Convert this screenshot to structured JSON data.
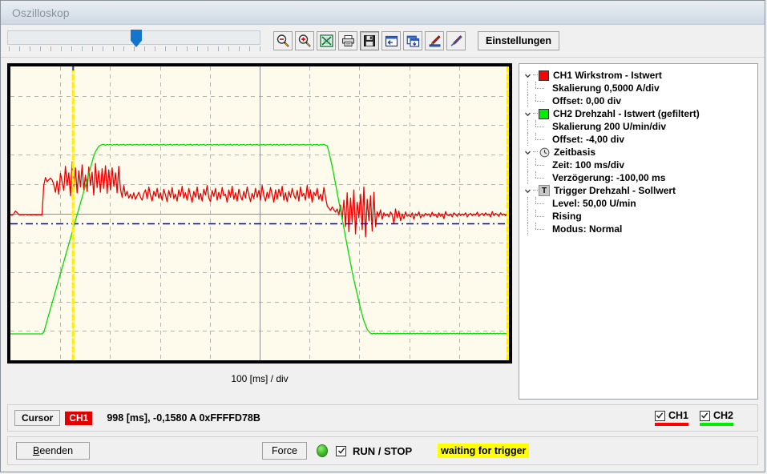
{
  "window": {
    "title": "Oszilloskop"
  },
  "toolbar": {
    "slider": {
      "name": "time-position-slider",
      "value": 50,
      "tick_count": 25
    },
    "buttons": [
      {
        "name": "zoom-out-button",
        "icon": "zoom-out-icon",
        "tooltip": "Zoom Out"
      },
      {
        "name": "zoom-in-button",
        "icon": "zoom-in-icon",
        "tooltip": "Zoom In"
      },
      {
        "name": "excel-export-button",
        "icon": "excel-icon",
        "tooltip": "Export Excel"
      },
      {
        "name": "print-button",
        "icon": "printer-icon",
        "tooltip": "Drucken"
      },
      {
        "name": "save-button",
        "icon": "floppy-disk-icon",
        "tooltip": "Speichern"
      },
      {
        "name": "load-window-button",
        "icon": "window-import-icon",
        "tooltip": "Laden"
      },
      {
        "name": "copy-window-button",
        "icon": "window-copy-icon",
        "tooltip": "Kopieren"
      },
      {
        "name": "marker-pen-button",
        "icon": "pen-blue-icon",
        "tooltip": "Marker"
      },
      {
        "name": "line-pen-button",
        "icon": "pen-line-icon",
        "tooltip": "Linie"
      }
    ],
    "settings_label": "Einstellungen"
  },
  "scope": {
    "x_axis_label": "100 [ms] / div",
    "colors": {
      "background": "#fffbec",
      "grid": "#b4b4b4",
      "axis": "#909090",
      "ch1": "#ee0000",
      "ch2": "#00dd00",
      "cursor": "#ffee00",
      "trigger_level": "#0000cc",
      "border": "#000000"
    },
    "grid": {
      "x_divisions": 10,
      "y_divisions": 10,
      "show": true
    },
    "cursor_position_div": 1.25,
    "trigger_level_y_div": 5.35
  },
  "tree": {
    "nodes": [
      {
        "name": "ch1-node",
        "icon": "color-swatch-red",
        "color": "#ff0000",
        "label": "CH1 Wirkstrom - Istwert",
        "children": [
          "Skalierung 0,5000 A/div",
          "Offset: 0,00  div"
        ]
      },
      {
        "name": "ch2-node",
        "icon": "color-swatch-green",
        "color": "#00ee00",
        "label": "CH2 Drehzahl - Istwert (gefiltert)",
        "children": [
          "Skalierung 200  U/min/div",
          "Offset: -4,00  div"
        ]
      },
      {
        "name": "timebase-node",
        "icon": "clock-icon",
        "label": "Zeitbasis",
        "children": [
          "Zeit: 100  ms/div",
          "Verzögerung: -100,00  ms"
        ]
      },
      {
        "name": "trigger-node",
        "icon": "trigger-t-icon",
        "label": "Trigger Drehzahl - Sollwert",
        "children": [
          "Level: 50,00   U/min",
          "Rising",
          "Modus: Normal"
        ]
      }
    ]
  },
  "status": {
    "cursor_button_label": "Cursor",
    "cursor_channel_badge": "CH1",
    "cursor_readout": "998 [ms], -0,1580 A 0xFFFFD78B",
    "channels": [
      {
        "name": "ch1-visibility-checkbox",
        "label": "CH1",
        "checked": true,
        "color": "#ff0000"
      },
      {
        "name": "ch2-visibility-checkbox",
        "label": "CH2",
        "checked": true,
        "color": "#00ee00"
      }
    ]
  },
  "footer": {
    "quit_label_accel": "B",
    "quit_label_rest": "eenden",
    "force_label": "Force",
    "led_color": "#3fb82b",
    "run_stop_label": "RUN / STOP",
    "run_stop_checked": true,
    "trigger_status": "waiting for trigger",
    "trigger_status_bg": "#ffff00"
  },
  "chart_data": {
    "type": "line",
    "title": "Oszilloskop Kanalverlauf",
    "xlabel": "100 [ms] / div",
    "ylabel": "",
    "grid": true,
    "x_divisions": 10,
    "y_divisions": 10,
    "legend": [
      "CH1 Wirkstrom - Istwert",
      "CH2 Drehzahl - Istwert (gefiltert)"
    ],
    "annotations": [
      {
        "type": "vline",
        "name": "cursor",
        "x_div": 1.25,
        "color": "#ffee00"
      },
      {
        "type": "vline",
        "name": "cursor-right",
        "x_div": 10.0,
        "color": "#ffee00"
      },
      {
        "type": "hline",
        "name": "trigger-level",
        "y_div": 5.35,
        "color": "#0000cc",
        "style": "dashdot"
      },
      {
        "type": "hline",
        "name": "center-axis",
        "y_div": 5.0,
        "color": "#909090",
        "style": "solid"
      },
      {
        "type": "vline",
        "name": "center-axis-v",
        "x_div": 5.0,
        "color": "#909090",
        "style": "solid"
      }
    ],
    "series": [
      {
        "name": "CH1 Wirkstrom - Istwert",
        "color": "#ee0000",
        "unit": "A",
        "scale_per_div": 0.5,
        "offset_div": 0.0,
        "values_div": [
          5.05,
          5.06,
          5.02,
          4.92,
          4.97,
          5.04,
          5.05,
          5.04,
          5.05,
          5.03,
          5.05,
          5.04,
          5.05,
          5.05,
          5.04,
          5.05,
          5.05,
          5.04,
          5.05,
          5.05,
          4.05,
          3.78,
          3.92,
          3.86,
          3.8,
          3.86,
          4.02,
          4.28,
          3.9,
          4.35,
          3.64,
          3.92,
          4.22,
          3.4,
          4.05,
          3.62,
          4.4,
          3.25,
          4.15,
          3.45,
          4.3,
          3.55,
          4.1,
          3.35,
          4.2,
          3.7,
          4.25,
          3.42,
          4.05,
          3.6,
          4.38,
          3.3,
          4.12,
          3.55,
          4.28,
          3.48,
          4.15,
          3.38,
          4.32,
          3.52,
          4.2,
          3.45,
          4.08,
          3.62,
          4.3,
          3.4,
          4.18,
          4.45,
          4.05,
          4.4,
          4.25,
          4.48,
          4.35,
          4.5,
          4.3,
          4.52,
          4.4,
          4.28,
          4.45,
          4.55,
          4.32,
          4.2,
          4.5,
          4.1,
          4.38,
          4.58,
          4.25,
          4.42,
          4.15,
          4.48,
          4.3,
          4.55,
          4.18,
          4.38,
          4.6,
          4.22,
          4.45,
          4.12,
          4.5,
          4.35,
          4.58,
          4.2,
          4.42,
          4.08,
          4.48,
          4.3,
          4.55,
          4.15,
          4.4,
          4.62,
          4.25,
          4.45,
          4.1,
          4.52,
          4.32,
          4.58,
          4.18,
          4.38,
          4.05,
          4.48,
          4.6,
          4.22,
          4.42,
          4.15,
          4.55,
          4.28,
          4.5,
          4.12,
          4.4,
          4.35,
          4.62,
          4.2,
          4.45,
          4.08,
          4.52,
          4.3,
          4.58,
          4.18,
          4.42,
          4.55,
          4.25,
          4.48,
          4.1,
          4.38,
          4.6,
          4.32,
          4.5,
          4.15,
          4.45,
          4.22,
          4.55,
          4.05,
          4.4,
          4.58,
          4.28,
          4.48,
          4.12,
          4.35,
          4.62,
          4.2,
          4.52,
          4.18,
          4.42,
          4.08,
          4.55,
          4.3,
          4.6,
          4.25,
          4.45,
          4.15,
          4.38,
          4.5,
          4.22,
          4.58,
          4.1,
          4.42,
          4.32,
          4.55,
          4.05,
          4.48,
          4.2,
          4.62,
          4.28,
          4.4,
          4.15,
          4.52,
          4.35,
          4.58,
          4.12,
          4.45,
          4.75,
          4.82,
          4.9,
          4.78,
          4.88,
          4.95,
          4.85,
          5.05,
          4.72,
          5.2,
          4.55,
          5.45,
          4.3,
          5.62,
          4.48,
          5.3,
          4.2,
          5.7,
          4.62,
          5.15,
          4.35,
          5.55,
          4.1,
          5.8,
          4.52,
          5.25,
          4.4,
          5.6,
          4.28,
          5.45,
          4.95,
          5.1,
          4.88,
          5.2,
          4.98,
          5.08,
          5.02,
          5.12,
          4.95,
          5.05,
          5.35,
          4.85,
          5.15,
          4.92,
          5.25,
          5.02,
          5.18,
          4.95,
          5.1,
          5.05,
          5.12,
          4.98,
          5.2,
          5.02,
          5.08,
          4.95,
          5.15,
          5.05,
          5.1,
          5.0,
          5.06,
          5.02,
          5.12,
          4.96,
          5.08,
          5.04,
          5.14,
          4.98,
          5.1,
          5.02,
          5.18,
          4.94,
          5.06,
          5.08,
          5.02,
          5.12,
          4.98,
          5.04,
          5.1,
          5.0,
          5.08,
          5.02,
          5.06,
          4.98,
          5.12,
          5.04,
          5.0,
          5.08,
          5.02,
          5.06,
          4.96,
          5.1,
          5.04,
          5.0,
          5.08,
          4.98,
          5.06,
          5.02,
          5.12,
          4.94,
          5.08,
          5.0,
          5.04,
          5.1,
          4.98,
          5.06,
          5.02,
          5.08,
          5.0,
          5.05
        ]
      },
      {
        "name": "CH2 Drehzahl - Istwert (gefiltert)",
        "color": "#00dd00",
        "unit": "U/min",
        "scale_per_div": 200,
        "offset_div": -4.0,
        "values_div": [
          9.1,
          9.1,
          9.1,
          9.1,
          9.1,
          9.1,
          9.1,
          9.1,
          9.1,
          9.1,
          9.1,
          9.1,
          9.1,
          9.1,
          9.1,
          9.1,
          9.1,
          9.1,
          9.1,
          9.1,
          9.05,
          8.85,
          8.65,
          8.45,
          8.25,
          8.05,
          7.85,
          7.65,
          7.45,
          7.25,
          7.05,
          6.85,
          6.65,
          6.45,
          6.25,
          6.05,
          5.85,
          5.65,
          5.45,
          5.25,
          5.05,
          4.85,
          4.65,
          4.45,
          4.25,
          4.05,
          3.85,
          3.65,
          3.45,
          3.25,
          3.05,
          2.9,
          2.8,
          2.72,
          2.68,
          2.66,
          2.65,
          2.68,
          2.66,
          2.67,
          2.65,
          2.68,
          2.66,
          2.67,
          2.65,
          2.68,
          2.66,
          2.67,
          2.65,
          2.68,
          2.66,
          2.67,
          2.65,
          2.68,
          2.66,
          2.67,
          2.65,
          2.68,
          2.66,
          2.67,
          2.65,
          2.68,
          2.66,
          2.67,
          2.65,
          2.68,
          2.66,
          2.67,
          2.65,
          2.68,
          2.66,
          2.67,
          2.65,
          2.68,
          2.66,
          2.67,
          2.65,
          2.68,
          2.66,
          2.67,
          2.65,
          2.68,
          2.66,
          2.67,
          2.65,
          2.68,
          2.66,
          2.67,
          2.65,
          2.68,
          2.66,
          2.67,
          2.65,
          2.68,
          2.66,
          2.67,
          2.65,
          2.68,
          2.66,
          2.67,
          2.65,
          2.68,
          2.66,
          2.67,
          2.65,
          2.68,
          2.66,
          2.67,
          2.65,
          2.68,
          2.66,
          2.67,
          2.65,
          2.68,
          2.66,
          2.67,
          2.65,
          2.68,
          2.66,
          2.67,
          2.65,
          2.68,
          2.66,
          2.67,
          2.65,
          2.68,
          2.66,
          2.67,
          2.65,
          2.68,
          2.66,
          2.67,
          2.65,
          2.68,
          2.66,
          2.67,
          2.65,
          2.68,
          2.66,
          2.67,
          2.65,
          2.68,
          2.66,
          2.67,
          2.65,
          2.68,
          2.66,
          2.67,
          2.65,
          2.68,
          2.66,
          2.67,
          2.65,
          2.68,
          2.66,
          2.67,
          2.65,
          2.68,
          2.66,
          2.67,
          2.65,
          2.68,
          2.66,
          2.67,
          2.65,
          2.68,
          2.66,
          2.67,
          2.65,
          2.68,
          2.7,
          2.9,
          3.15,
          3.4,
          3.7,
          4.0,
          4.3,
          4.6,
          4.9,
          5.2,
          5.5,
          5.8,
          6.1,
          6.4,
          6.7,
          7.0,
          7.25,
          7.5,
          7.75,
          8.0,
          8.25,
          8.45,
          8.65,
          8.8,
          8.95,
          9.02,
          9.08,
          9.1,
          9.08,
          9.1,
          9.08,
          9.1,
          9.08,
          9.1,
          9.08,
          9.1,
          9.08,
          9.1,
          9.08,
          9.1,
          9.08,
          9.1,
          9.08,
          9.1,
          9.08,
          9.1,
          9.08,
          9.1,
          9.08,
          9.1,
          9.08,
          9.1,
          9.08,
          9.1,
          9.08,
          9.1,
          9.08,
          9.1,
          9.08,
          9.1,
          9.08,
          9.1,
          9.08,
          9.1,
          9.08,
          9.1,
          9.08,
          9.1,
          9.08,
          9.1,
          9.08,
          9.1,
          9.08,
          9.1,
          9.08,
          9.1,
          9.08,
          9.1,
          9.08,
          9.1,
          9.08,
          9.1,
          9.08,
          9.1,
          9.08,
          9.1,
          9.08,
          9.1,
          9.08,
          9.1,
          9.08,
          9.1,
          9.08,
          9.1,
          9.08,
          9.1,
          9.08,
          9.1,
          9.08,
          9.1,
          9.08,
          9.1,
          9.08,
          9.1,
          9.08,
          9.1,
          9.08,
          9.1,
          9.08,
          9.1
        ]
      }
    ]
  }
}
